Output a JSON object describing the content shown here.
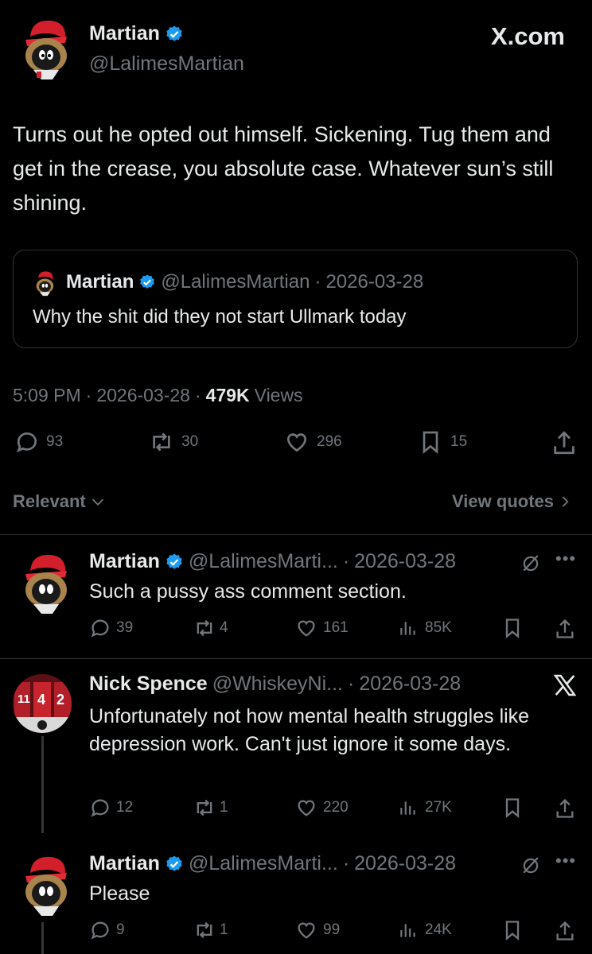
{
  "main_post": {
    "author_name": "Martian",
    "author_handle": "@LalimesMartian",
    "brand": "X.com",
    "text": "Turns out he opted out himself. Sickening. Tug them and get in the crease, you absolute case. Whatever sun’s still shining.",
    "quoted": {
      "author_name": "Martian",
      "author_handle": "@LalimesMartian",
      "separator": "·",
      "date": "2026-03-28",
      "text": "Why the shit did they not start Ullmark today"
    },
    "time": "5:09 PM",
    "sep1": "·",
    "date": "2026-03-28",
    "sep2": "·",
    "views_count": "479K",
    "views_label": "Views",
    "stats": {
      "replies": "93",
      "reposts": "30",
      "likes": "296",
      "bookmarks": "15"
    }
  },
  "filter": {
    "label": "Relevant",
    "chevron": "chevron-down-icon",
    "view_quotes": "View quotes"
  },
  "replies": [
    {
      "author_name": "Martian",
      "author_handle": "@LalimesMarti...",
      "separator": "·",
      "date": "2026-03-28",
      "text": "Such a pussy ass comment section.",
      "stats": {
        "replies": "39",
        "reposts": "4",
        "likes": "161",
        "views": "85K"
      }
    },
    {
      "author_name": "Nick Spence",
      "author_handle": "@WhiskeyNi...",
      "separator": "·",
      "date": "2026-03-28",
      "text": "Unfortunately not how mental health struggles like depression work. Can't just ignore it some days.",
      "stats": {
        "replies": "12",
        "reposts": "1",
        "likes": "220",
        "views": "27K"
      }
    },
    {
      "author_name": "Martian",
      "author_handle": "@LalimesMarti...",
      "separator": "·",
      "date": "2026-03-28",
      "text": "Please",
      "stats": {
        "replies": "9",
        "reposts": "1",
        "likes": "99",
        "views": "24K"
      }
    }
  ],
  "colors": {
    "background": "#000000",
    "text": "#e7e9ea",
    "muted": "#71767b",
    "verified": "#1d9bf0",
    "divider": "#2f3336"
  }
}
